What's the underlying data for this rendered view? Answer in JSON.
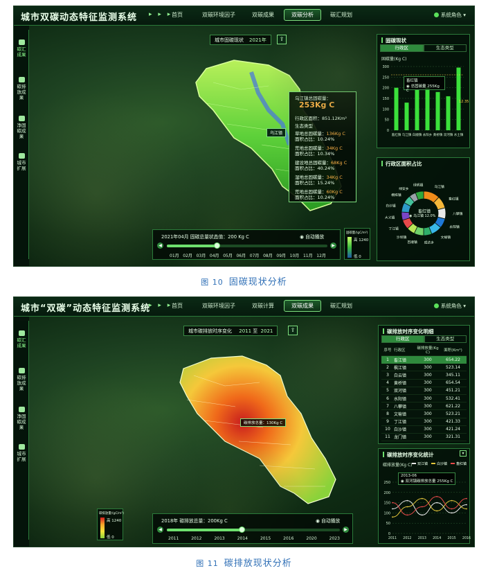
{
  "figure1": {
    "caption_num": "图 10",
    "caption_text": "固碳现状分析",
    "app_title": "城市双碳动态特征监测系统",
    "nav_arrows": "▸ ▸ ▸",
    "nav": [
      "首页",
      "双碳环境因子",
      "双碳成果",
      "双碳分析",
      "碳汇规划"
    ],
    "active_nav": "双碳分析",
    "user": "系统角色 ▾",
    "sidebar": [
      {
        "label": "碳汇成果",
        "icon": "tree-icon"
      },
      {
        "label": "碳排放成果",
        "icon": "factory-icon"
      },
      {
        "label": "净固碳成果",
        "icon": "balance-icon"
      },
      {
        "label": "城市扩展",
        "icon": "building-icon"
      }
    ],
    "query_label": "城市固碳现状",
    "query_year": "2021年",
    "region_label": "乌江镇",
    "popup": {
      "title": "乌江镇总固碳量：",
      "total": "253Kg C",
      "area": "行政区面积：851.12Km²",
      "eco_title": "生态类型",
      "rows": [
        {
          "name": "草地总固碳量：",
          "value": "136Kg C",
          "ratio": "面积占比：10.24%"
        },
        {
          "name": "荒地总固碳量：",
          "value": "34Kg C",
          "ratio": "面积占比：10.34%"
        },
        {
          "name": "建设地总固碳量：",
          "value": "68Kg C",
          "ratio": "面积占比：40.24%"
        },
        {
          "name": "湿地总固碳量：",
          "value": "34Kg C",
          "ratio": "面积占比：15.24%"
        },
        {
          "name": "荒地总固碳量：",
          "value": "60Kg C",
          "ratio": "面积占比：10.24%"
        }
      ]
    },
    "timeline": {
      "head": "2021年04月  固碳总量状态值：200 Kg C",
      "auto": "◉ 自动播放",
      "labels": [
        "01月",
        "02月",
        "03月",
        "04月",
        "05月",
        "06月",
        "07月",
        "08月",
        "09月",
        "10月",
        "11月",
        "12月"
      ],
      "progress": 0.31
    },
    "legend": {
      "title": "固碳量/(gC/m²)",
      "high": "高 1240",
      "low": "低 0"
    },
    "panel_top": {
      "title": "固碳现状",
      "tabs": [
        "行政区",
        "生态类型"
      ],
      "unit": "固碳量(Kg C)",
      "tooltip_name": "畜红镇",
      "tooltip_line": "◉ 总固碳量  255Kg C",
      "tooltip_line_value": "12.35",
      "y_ticks": [
        "300",
        "250",
        "200",
        "150",
        "100",
        "50",
        "0"
      ]
    },
    "panel_bottom": {
      "title": "行政区面积占比",
      "center_name": "畜红镇",
      "center_sub": "◉ 乌江镇  12.0%",
      "labels": [
        "乌江镇",
        "畜红镇",
        "八攀镇",
        "永阳镇",
        "文榆镇",
        "成达乡",
        "百顺镇",
        "沙坝镇",
        "丁江镇",
        "大义镇",
        "白沙镇",
        "桐梓镇",
        "绿安乡",
        "绿帆镇"
      ]
    }
  },
  "figure2": {
    "caption_num": "图 11",
    "caption_text": "碳排放现状分析",
    "app_title": "城市“双碳”动态特征监测系统",
    "nav_arrows": "▸ ▸ ▸",
    "nav": [
      "首页",
      "双碳环境因子",
      "双碳计算",
      "双碳成果",
      "碳汇规划"
    ],
    "active_nav": "双碳成果",
    "user": "系统角色 ▾",
    "sidebar": [
      {
        "label": "碳汇成果",
        "icon": "tree-icon"
      },
      {
        "label": "碳排放成果",
        "icon": "factory-icon"
      },
      {
        "label": "净固碳成果",
        "icon": "balance-icon"
      },
      {
        "label": "城市扩展",
        "icon": "building-icon"
      }
    ],
    "query_label": "城市碳排放时序变化",
    "year_from": "2011",
    "year_sep": "至",
    "year_to": "2021",
    "map_tooltip": "碳排放总量：130Kg C",
    "timeline": {
      "head": "2018年  碳排放总量：200Kg C",
      "auto": "◉ 自动播放",
      "labels": [
        "2011",
        "2012",
        "2013",
        "2014",
        "2015",
        "2016",
        "2020",
        "2023"
      ],
      "progress": 0.43
    },
    "legend": {
      "title": "碳排放量/(gC/m²)",
      "high": "高 1240",
      "low": "低 0"
    },
    "table_panel": {
      "title": "碳排放时序变化明细",
      "tabs": [
        "行政区",
        "生态类型"
      ],
      "headers": [
        "序号",
        "行政区",
        "碳排放量(Kg C)",
        "面积(Km²)"
      ],
      "rows": [
        [
          "1",
          "畜江镇",
          "300",
          "654.22"
        ],
        [
          "2",
          "枫江镇",
          "300",
          "523.14"
        ],
        [
          "3",
          "白云镇",
          "300",
          "345.11"
        ],
        [
          "4",
          "黄桥镇",
          "300",
          "654.54"
        ],
        [
          "5",
          "双河镇",
          "300",
          "451.21"
        ],
        [
          "6",
          "水阳镇",
          "300",
          "532.41"
        ],
        [
          "7",
          "八攀镇",
          "300",
          "621.22"
        ],
        [
          "8",
          "文榆镇",
          "300",
          "523.21"
        ],
        [
          "9",
          "丁江镇",
          "300",
          "421.33"
        ],
        [
          "10",
          "白沙镇",
          "300",
          "421.24"
        ],
        [
          "11",
          "龙门镇",
          "300",
          "321.31"
        ]
      ],
      "selected_row": 0
    },
    "chart_panel": {
      "title": "碳排放时序变化统计",
      "unit": "碳排放量(Kg C)",
      "legend": [
        "双江镇",
        "白沙镇",
        "畜红镇"
      ],
      "tooltip_year": "2013-06",
      "tooltip_line": "◉ 双河镇碳排放总量  255Kg C",
      "y_ticks": [
        "250",
        "200",
        "150",
        "100",
        "50",
        "0"
      ],
      "x_ticks": [
        "2011",
        "2012",
        "2013",
        "2014",
        "2015",
        "2016"
      ]
    }
  },
  "chart_data": [
    {
      "type": "bar",
      "categories": [
        "畜红镇",
        "乌江镇",
        "白顺镇",
        "永阳乡",
        "黄桥镇",
        "双河镇",
        "水土镇"
      ],
      "values": [
        200,
        130,
        190,
        200,
        180,
        160,
        295
      ],
      "ylabel": "固碳量(Kg C)",
      "ylim": [
        0,
        300
      ],
      "colors": [
        "#3be03b",
        "#3be03b",
        "#3be03b",
        "#3be03b",
        "#3be03b",
        "#3be03b",
        "#3be03b"
      ]
    },
    {
      "type": "pie",
      "donut": true,
      "categories": [
        "乌江镇",
        "畜红镇",
        "八攀镇",
        "永阳镇",
        "文榆镇",
        "成达乡",
        "百顺镇",
        "沙坝镇",
        "丁江镇",
        "大义镇",
        "白沙镇",
        "桐梓镇",
        "绿安乡",
        "绿帆镇"
      ],
      "values": [
        12,
        9,
        8,
        7,
        8,
        6,
        7,
        6,
        7,
        6,
        7,
        6,
        5,
        6
      ],
      "colors": [
        "#f08c1a",
        "#f5b73a",
        "#e8e8e8",
        "#1e78d8",
        "#39b8e8",
        "#2fae6a",
        "#71d36b",
        "#b9e85a",
        "#e84a4a",
        "#7a45c8",
        "#2d9ac8",
        "#43c29b",
        "#9aa0a8",
        "#2ea83e"
      ]
    },
    {
      "type": "line",
      "x": [
        "2011",
        "2012",
        "2013",
        "2014",
        "2015",
        "2016"
      ],
      "series": [
        {
          "name": "双江镇",
          "values": [
            120,
            160,
            90,
            150,
            100,
            140
          ],
          "color": "#e8e8e8"
        },
        {
          "name": "白沙镇",
          "values": [
            80,
            130,
            170,
            110,
            160,
            120
          ],
          "color": "#e2c53b"
        },
        {
          "name": "畜红镇",
          "values": [
            150,
            90,
            130,
            180,
            120,
            170
          ],
          "color": "#e84a4a"
        }
      ],
      "ylabel": "碳排放量(Kg C)",
      "ylim": [
        0,
        250
      ]
    }
  ]
}
